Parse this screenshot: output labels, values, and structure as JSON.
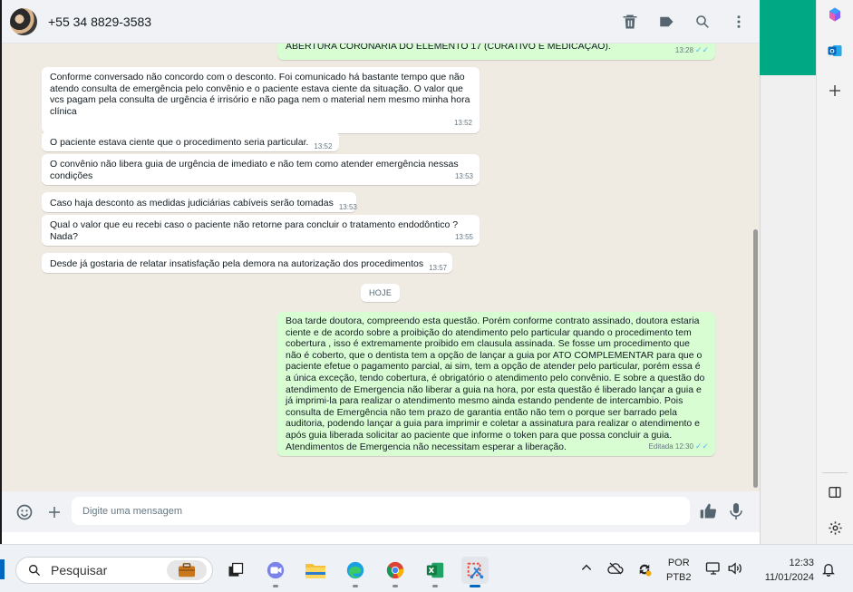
{
  "header": {
    "contact_name": "+55 34 8829-3583",
    "icons": [
      "trash-icon",
      "label-icon",
      "search-icon",
      "menu-dots-icon"
    ]
  },
  "messages": [
    {
      "dir": "out",
      "text": "ABERTURA CORONÁRIA DO ELEMENTO 17 (CURATIVO E MEDICAÇÃO).",
      "time": "13:28"
    },
    {
      "dir": "in",
      "text": "Conforme conversado não concordo com o desconto. Foi comunicado há bastante tempo que não atendo consulta de emergência pelo convênio e o paciente estava ciente da situação. O valor que vcs pagam pela consulta de urgência é irrisório e não paga nem o material nem mesmo minha hora clínica",
      "time": "13:52"
    },
    {
      "dir": "in",
      "text": "O paciente estava ciente que o procedimento seria particular.",
      "time": "13:52"
    },
    {
      "dir": "in",
      "text": "O convênio não libera guia de urgência de imediato e não tem como atender emergência nessas condições",
      "time": "13:53"
    },
    {
      "dir": "in",
      "text": "Caso haja desconto as medidas judiciárias cabíveis serão tomadas",
      "time": "13:53"
    },
    {
      "dir": "in",
      "text": "Qual o valor que eu recebi caso o paciente não retorne para concluir o tratamento endodôntico ? Nada?",
      "time": "13:55"
    },
    {
      "dir": "in",
      "text": "Desde já gostaria de relatar insatisfação pela demora na autorização dos procedimentos",
      "time": "13:57"
    },
    {
      "dir": "out",
      "text": "Boa tarde doutora, compreendo esta questão. Porém conforme contrato assinado, doutora estaria ciente e de acordo sobre a proibição do atendimento pelo particular quando o procedimento tem cobertura , isso é extremamente proibido em clausula assinada. Se fosse um procedimento que não é coberto, que o dentista tem a opção de lançar a guia por ATO COMPLEMENTAR para que o paciente efetue o pagamento parcial, ai sim, tem a opção de atender pelo particular, porém essa é a única exceção, tendo cobertura, é obrigatório o atendimento pelo convênio. E sobre a questão do atendimento de Emergencia não liberar a guia na hora, por esta questão é liberado lançar a guia e já imprimi-la para realizar o atendimento mesmo ainda estando pendente de intercambio. Pois consulta de Emergência não tem prazo de garantia então não tem o porque ser barrado pela auditoria, podendo lançar a guia para imprimir e coletar a assinatura para realizar o atendimento e após guia liberada solicitar ao paciente que informe o token para que possa concluir a guia. Atendimentos de Emergencia não necessitam esperar a liberação.",
      "time": "Editada 12:30"
    }
  ],
  "date_chip": "HOJE",
  "composer": {
    "placeholder": "Digite uma mensagem"
  },
  "taskbar": {
    "search_label": "Pesquisar",
    "lang_line1": "POR",
    "lang_line2": "PTB2",
    "time": "12:33",
    "date": "11/01/2024"
  },
  "colors": {
    "chat_bg": "#efeae2",
    "incoming_bubble": "#ffffff",
    "outgoing_bubble": "#d9fdd3",
    "accent_green": "#00a884",
    "read_ticks": "#53bdeb"
  }
}
